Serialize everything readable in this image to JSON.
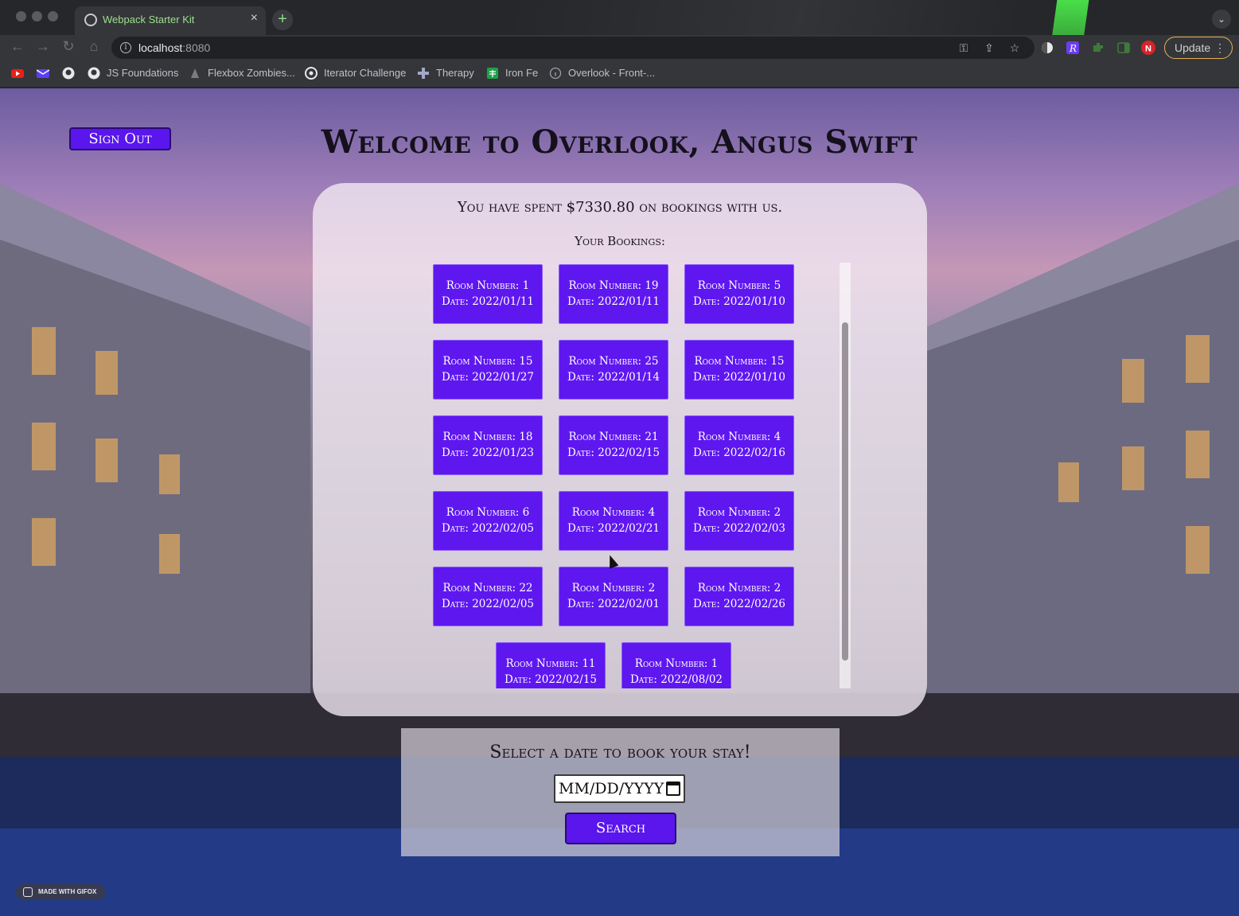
{
  "browser": {
    "tab_title": "Webpack Starter Kit",
    "tab_close": "×",
    "new_tab": "+",
    "tab_list": "⌄",
    "url_host": "localhost",
    "url_port": ":8080",
    "update_label": "Update",
    "profile_initial": "N",
    "bookmarks": [
      {
        "label": "JS Foundations"
      },
      {
        "label": "Flexbox Zombies..."
      },
      {
        "label": "Iterator Challenge"
      },
      {
        "label": "Therapy"
      },
      {
        "label": "Iron Fe"
      },
      {
        "label": "Overlook - Front-..."
      }
    ]
  },
  "page": {
    "sign_out_label": "Sign Out",
    "welcome_title": "Welcome to Overlook, Angus Swift",
    "spent_text": "You have spent $7330.80 on bookings with us.",
    "bookings_title": "Your Bookings:",
    "bookings": [
      {
        "room": "Room Number: 1",
        "date": "Date: 2022/01/11"
      },
      {
        "room": "Room Number: 19",
        "date": "Date: 2022/01/11"
      },
      {
        "room": "Room Number: 5",
        "date": "Date: 2022/01/10"
      },
      {
        "room": "Room Number: 15",
        "date": "Date: 2022/01/27"
      },
      {
        "room": "Room Number: 25",
        "date": "Date: 2022/01/14"
      },
      {
        "room": "Room Number: 15",
        "date": "Date: 2022/01/10"
      },
      {
        "room": "Room Number: 18",
        "date": "Date: 2022/01/23"
      },
      {
        "room": "Room Number: 21",
        "date": "Date: 2022/02/15"
      },
      {
        "room": "Room Number: 4",
        "date": "Date: 2022/02/16"
      },
      {
        "room": "Room Number: 6",
        "date": "Date: 2022/02/05"
      },
      {
        "room": "Room Number: 4",
        "date": "Date: 2022/02/21"
      },
      {
        "room": "Room Number: 2",
        "date": "Date: 2022/02/03"
      },
      {
        "room": "Room Number: 22",
        "date": "Date: 2022/02/05"
      },
      {
        "room": "Room Number: 2",
        "date": "Date: 2022/02/01"
      },
      {
        "room": "Room Number: 2",
        "date": "Date: 2022/02/26"
      },
      {
        "room": "Room Number: 11",
        "date": "Date: 2022/02/15"
      },
      {
        "room": "Room Number: 1",
        "date": "Date: 2022/08/02"
      }
    ],
    "book_title": "Select a date to book your stay!",
    "date_placeholder": "MM/DD/YYYY",
    "search_label": "Search",
    "gifox_label": "MADE WITH GIFOX"
  },
  "colors": {
    "accent": "#5a16ec",
    "booking_card": "#5f17f0"
  }
}
